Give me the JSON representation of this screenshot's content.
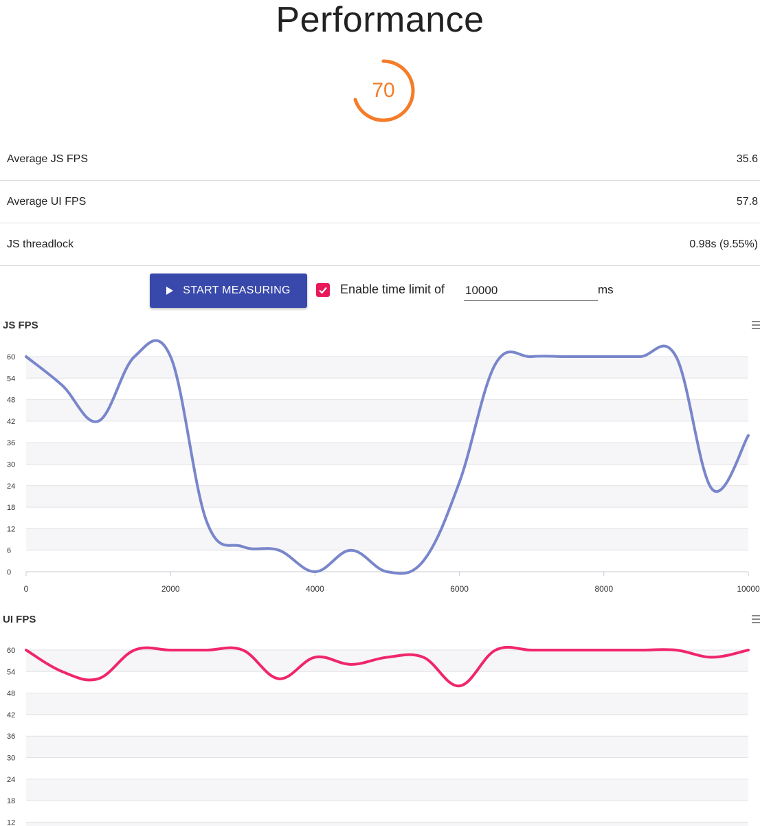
{
  "page": {
    "title": "Performance"
  },
  "score": {
    "value": "70",
    "color": "#f57c28",
    "fraction": 0.7
  },
  "metrics": [
    {
      "label": "Average JS FPS",
      "value": "35.6"
    },
    {
      "label": "Average UI FPS",
      "value": "57.8"
    },
    {
      "label": "JS threadlock",
      "value": "0.98s (9.55%)"
    }
  ],
  "controls": {
    "start_label": "START MEASURING",
    "start_icon": "play-icon",
    "checkbox_checked": true,
    "checkbox_label": "Enable time limit of",
    "time_limit_value": "10000",
    "unit_label": "ms",
    "accent_button": "#3949ab",
    "accent_checkbox": "#e8185b"
  },
  "chart_data": [
    {
      "type": "line",
      "title": "JS FPS",
      "color": "#7986cb",
      "xlim": [
        0,
        10000
      ],
      "ylim": [
        0,
        60
      ],
      "x_ticks": [
        "0",
        "2000",
        "4000",
        "6000",
        "8000",
        "10000"
      ],
      "y_ticks": [
        "0",
        "6",
        "12",
        "18",
        "24",
        "30",
        "36",
        "42",
        "48",
        "54",
        "60"
      ],
      "series": [
        {
          "x": [
            0,
            500,
            1000,
            1500,
            2000,
            2500,
            3000,
            3500,
            4000,
            4500,
            5000,
            5500,
            6000,
            6500,
            7000,
            7500,
            8000,
            8500,
            9000,
            9500,
            10000
          ],
          "values": [
            60,
            52,
            42,
            60,
            60,
            14,
            7,
            6,
            0,
            6,
            0,
            3,
            25,
            58,
            60,
            60,
            60,
            60,
            60,
            23,
            38
          ]
        }
      ]
    },
    {
      "type": "line",
      "title": "UI FPS",
      "color": "#f0266b",
      "xlim": [
        0,
        10000
      ],
      "ylim": [
        0,
        60
      ],
      "y_ticks": [
        "12",
        "18",
        "24",
        "30",
        "36",
        "42",
        "48",
        "54",
        "60"
      ],
      "series": [
        {
          "x": [
            0,
            500,
            1000,
            1500,
            2000,
            2500,
            3000,
            3500,
            4000,
            4500,
            5000,
            5500,
            6000,
            6500,
            7000,
            7500,
            8000,
            8500,
            9000,
            9500,
            10000
          ],
          "values": [
            60,
            54,
            52,
            60,
            60,
            60,
            60,
            52,
            58,
            56,
            58,
            58,
            50,
            60,
            60,
            60,
            60,
            60,
            60,
            58,
            60
          ]
        }
      ]
    }
  ]
}
